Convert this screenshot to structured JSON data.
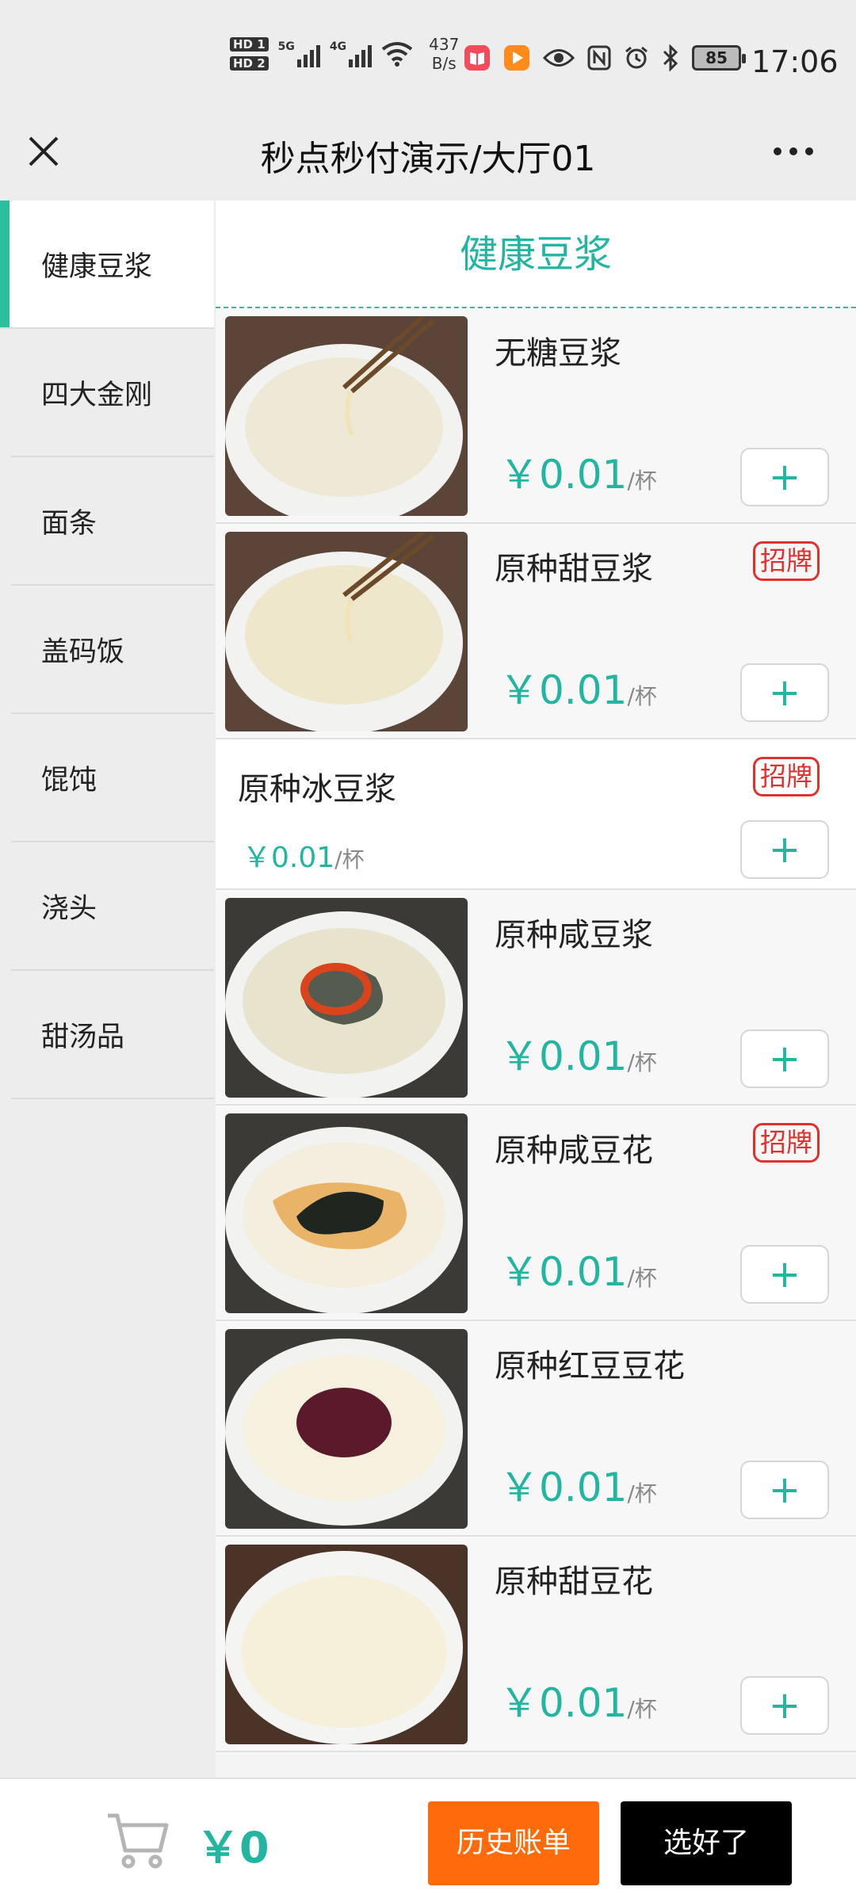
{
  "status_bar": {
    "hd1": "HD 1",
    "hd2": "HD 2",
    "sig1_label": "5G",
    "sig2_label": "4G",
    "speed_value": "437",
    "speed_unit": "B/s",
    "battery": "85",
    "time": "17:06",
    "icons": [
      "book-app-icon",
      "play-app-icon",
      "eye-icon",
      "nfc-icon",
      "alarm-icon",
      "bluetooth-icon"
    ]
  },
  "nav": {
    "title": "秒点秒付演示/大厅01"
  },
  "sidebar": {
    "items": [
      {
        "label": "健康豆浆",
        "active": true
      },
      {
        "label": "四大金刚"
      },
      {
        "label": "面条"
      },
      {
        "label": "盖码饭"
      },
      {
        "label": "馄饨"
      },
      {
        "label": "浇头"
      },
      {
        "label": "甜汤品"
      }
    ]
  },
  "main": {
    "section_title": "健康豆浆",
    "items": [
      {
        "name": "无糖豆浆",
        "price": "￥0.01",
        "unit": "/杯",
        "badge": "",
        "image": "plain-soy-milk-bowl"
      },
      {
        "name": "原种甜豆浆",
        "price": "￥0.01",
        "unit": "/杯",
        "badge": "招牌",
        "image": "sweet-soy-milk-bowl"
      },
      {
        "name": "原种冰豆浆",
        "price": "￥0.01",
        "unit": "/杯",
        "badge": "招牌",
        "image": ""
      },
      {
        "name": "原种咸豆浆",
        "price": "￥0.01",
        "unit": "/杯",
        "badge": "",
        "image": "savory-soy-milk-bowl"
      },
      {
        "name": "原种咸豆花",
        "price": "￥0.01",
        "unit": "/杯",
        "badge": "招牌",
        "image": "savory-tofu-pudding-bowl"
      },
      {
        "name": "原种红豆豆花",
        "price": "￥0.01",
        "unit": "/杯",
        "badge": "",
        "image": "red-bean-tofu-pudding-bowl"
      },
      {
        "name": "原种甜豆花",
        "price": "￥0.01",
        "unit": "/杯",
        "badge": "",
        "image": "sweet-tofu-pudding-bowl"
      }
    ],
    "add_label": "+"
  },
  "cart": {
    "total": "￥0",
    "history_label": "历史账单",
    "done_label": "选好了"
  },
  "colors": {
    "accent": "#22b5a0",
    "badge": "#e03030",
    "history_button": "#ff6a0a",
    "done_button": "#000000"
  }
}
